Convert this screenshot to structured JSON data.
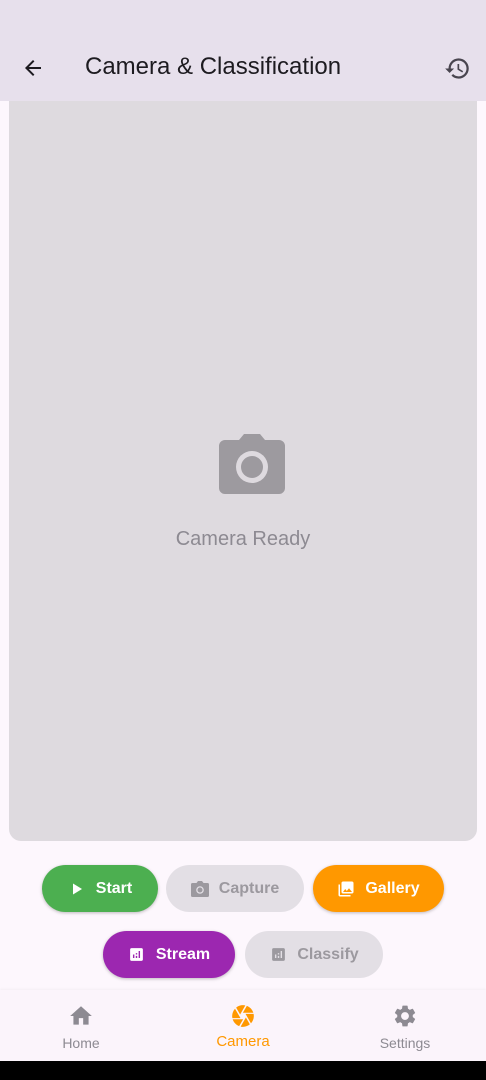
{
  "appbar": {
    "title": "Camera & Classification",
    "back_icon": "arrow-back-icon",
    "history_icon": "history-icon"
  },
  "preview": {
    "icon": "camera-icon",
    "status": "Camera Ready"
  },
  "actions": {
    "start": {
      "label": "Start",
      "icon": "play-icon",
      "color": "#4caf50",
      "enabled": true
    },
    "capture": {
      "label": "Capture",
      "icon": "camera-icon",
      "color": "#e3dfe5",
      "enabled": false
    },
    "gallery": {
      "label": "Gallery",
      "icon": "gallery-icon",
      "color": "#ff9800",
      "enabled": true
    },
    "stream": {
      "label": "Stream",
      "icon": "analytics-icon",
      "color": "#9c27b0",
      "enabled": true
    },
    "classify": {
      "label": "Classify",
      "icon": "analytics-icon",
      "color": "#e3dfe5",
      "enabled": false
    }
  },
  "bottom_nav": {
    "items": [
      {
        "label": "Home",
        "icon": "home-icon",
        "active": false
      },
      {
        "label": "Camera",
        "icon": "camera-shutter-icon",
        "active": true
      },
      {
        "label": "Settings",
        "icon": "gear-icon",
        "active": false
      }
    ],
    "active_color": "#ff9800"
  }
}
